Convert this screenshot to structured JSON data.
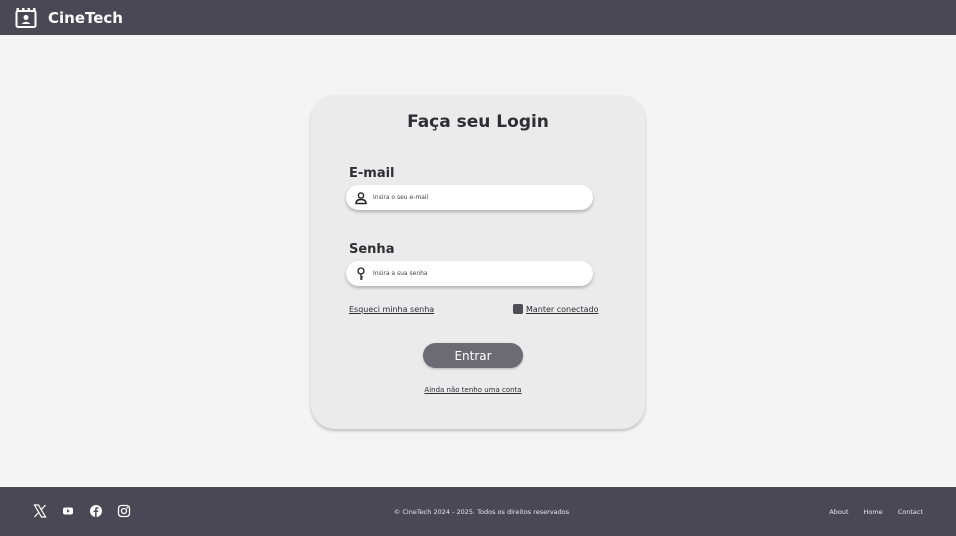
{
  "header": {
    "brand": "CineTech",
    "logo_icon": "clapperboard-icon"
  },
  "login": {
    "title": "Faça seu Login",
    "email_label": "E-mail",
    "email_placeholder": "Insira o seu e-mail",
    "email_value": "",
    "email_icon": "user-icon",
    "password_label": "Senha",
    "password_placeholder": "Insira a sua senha",
    "password_value": "",
    "password_icon": "key-icon",
    "forgot_link": "Esqueci minha senha",
    "remember_label": "Manter conectado",
    "remember_checked": true,
    "submit_label": "Entrar",
    "signup_link": "Ainda não tenho uma conta"
  },
  "footer": {
    "socials": [
      "x-icon",
      "youtube-icon",
      "facebook-icon",
      "instagram-icon"
    ],
    "copyright": "© CineTech 2024 - 2025. Todos os direitos reservados",
    "links": [
      "About",
      "Home",
      "Contact"
    ]
  },
  "colors": {
    "bar": "#4a4854",
    "page_bg": "#f4f4f4",
    "card_bg": "#ebebeb",
    "button": "#6c6a72"
  }
}
